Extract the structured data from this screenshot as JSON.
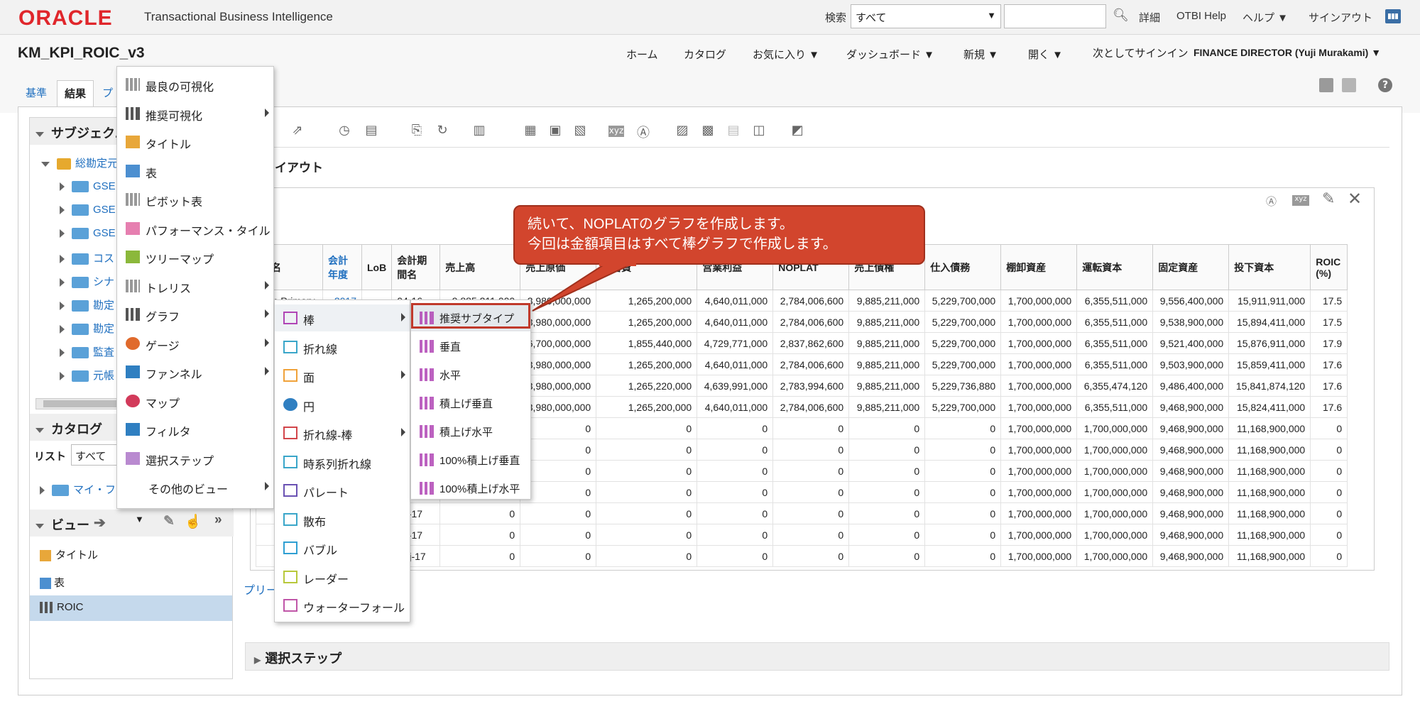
{
  "app": {
    "logo": "ORACLE",
    "product": "Transactional Business Intelligence",
    "search_label": "検索",
    "search_scope": "すべて",
    "detail": "詳細",
    "otbi_help": "OTBI Help",
    "help": "ヘルプ ▼",
    "signout": "サインアウト"
  },
  "page": {
    "title": "KM_KPI_ROIC_v3",
    "nav": [
      "ホーム",
      "カタログ",
      "お気に入り ▼",
      "ダッシュボード ▼",
      "新規 ▼",
      "開く ▼"
    ],
    "signin_as_label": "次としてサインイン",
    "signin_user": "FINANCE DIRECTOR (Yuji Murakami) ▼",
    "tabs": [
      "基準",
      "結果",
      "プ"
    ]
  },
  "left": {
    "subject_header": "サブジェク...",
    "root_item": "総勘定元",
    "tree": [
      "GSE",
      "GSE",
      "GSE",
      "コス",
      "シナ",
      "勘定",
      "勘定",
      "監査",
      "元帳"
    ],
    "catalog_header": "カタログ",
    "list_label": "リスト",
    "list_value": "すべて",
    "my_folder": "マイ・フ",
    "views_header": "ビュー",
    "views": [
      "タイトル",
      "表",
      "ROIC"
    ]
  },
  "content": {
    "layout_title": "レイアウト",
    "preview_link": "プリー",
    "selection_steps": "選択ステップ"
  },
  "callout": {
    "line1": "続いて、NOPLATのグラフを作成します。",
    "line2": "今回は金額項目はすべて棒グラフで作成します。"
  },
  "menu1": [
    {
      "label": "最良の可視化",
      "icon": "grid-icon"
    },
    {
      "label": "推奨可視化",
      "icon": "bar-chart-icon"
    },
    {
      "label": "タイトル",
      "icon": "title-icon"
    },
    {
      "label": "表",
      "icon": "table-icon"
    },
    {
      "label": "ピボット表",
      "icon": "pivot-icon"
    },
    {
      "label": "パフォーマンス・タイル",
      "icon": "tile-icon"
    },
    {
      "label": "ツリーマップ",
      "icon": "treemap-icon"
    },
    {
      "label": "トレリス",
      "icon": "trellis-icon"
    },
    {
      "label": "グラフ",
      "icon": "graph-icon"
    },
    {
      "label": "ゲージ",
      "icon": "gauge-icon"
    },
    {
      "label": "ファンネル",
      "icon": "funnel-icon"
    },
    {
      "label": "マップ",
      "icon": "map-icon"
    },
    {
      "label": "フィルタ",
      "icon": "filter-icon"
    },
    {
      "label": "選択ステップ",
      "icon": "selection-steps-icon"
    },
    {
      "label": "その他のビュー",
      "icon": ""
    }
  ],
  "menu2": [
    "棒",
    "折れ線",
    "面",
    "円",
    "折れ線-棒",
    "時系列折れ線",
    "パレート",
    "散布",
    "バブル",
    "レーダー",
    "ウォーターフォール"
  ],
  "menu3": [
    "推奨サブタイプ",
    "垂直",
    "水平",
    "積上げ垂直",
    "積上げ水平",
    "100%積上げ垂直",
    "100%積上げ水平"
  ],
  "table": {
    "headers": [
      "帳名",
      "会計年度",
      "LoB",
      "会計期間名",
      "売上高",
      "売上原価",
      "販管費",
      "営業利益",
      "NOPLAT",
      "売上債権",
      "仕入債務",
      "棚卸資産",
      "運転資本",
      "固定資産",
      "投下資本",
      "ROIC (%)"
    ],
    "rows": [
      [
        "pan Primary",
        "2017",
        "",
        "04-16",
        "9,885,211,000",
        "3,980,000,000",
        "1,265,200,000",
        "4,640,011,000",
        "2,784,006,600",
        "9,885,211,000",
        "5,229,700,000",
        "1,700,000,000",
        "6,355,511,000",
        "9,556,400,000",
        "15,911,911,000",
        "17.5"
      ],
      [
        "",
        "",
        "",
        "",
        "0",
        "3,980,000,000",
        "1,265,200,000",
        "4,640,011,000",
        "2,784,006,600",
        "9,885,211,000",
        "5,229,700,000",
        "1,700,000,000",
        "6,355,511,000",
        "9,538,900,000",
        "15,894,411,000",
        "17.5"
      ],
      [
        "",
        "",
        "",
        "",
        "0",
        "6,700,000,000",
        "1,855,440,000",
        "4,729,771,000",
        "2,837,862,600",
        "9,885,211,000",
        "5,229,700,000",
        "1,700,000,000",
        "6,355,511,000",
        "9,521,400,000",
        "15,876,911,000",
        "17.9"
      ],
      [
        "",
        "",
        "",
        "",
        "0",
        "3,980,000,000",
        "1,265,200,000",
        "4,640,011,000",
        "2,784,006,600",
        "9,885,211,000",
        "5,229,700,000",
        "1,700,000,000",
        "6,355,511,000",
        "9,503,900,000",
        "15,859,411,000",
        "17.6"
      ],
      [
        "",
        "",
        "",
        "",
        "0",
        "3,980,000,000",
        "1,265,220,000",
        "4,639,991,000",
        "2,783,994,600",
        "9,885,211,000",
        "5,229,736,880",
        "1,700,000,000",
        "6,355,474,120",
        "9,486,400,000",
        "15,841,874,120",
        "17.6"
      ],
      [
        "",
        "",
        "",
        "",
        "0",
        "3,980,000,000",
        "1,265,200,000",
        "4,640,011,000",
        "2,784,006,600",
        "9,885,211,000",
        "5,229,700,000",
        "1,700,000,000",
        "6,355,511,000",
        "9,468,900,000",
        "15,824,411,000",
        "17.6"
      ],
      [
        "",
        "",
        "",
        "",
        "0",
        "0",
        "0",
        "0",
        "0",
        "0",
        "0",
        "1,700,000,000",
        "1,700,000,000",
        "9,468,900,000",
        "11,168,900,000",
        "0"
      ],
      [
        "",
        "",
        "",
        "",
        "0",
        "0",
        "0",
        "0",
        "0",
        "0",
        "0",
        "1,700,000,000",
        "1,700,000,000",
        "9,468,900,000",
        "11,168,900,000",
        "0"
      ],
      [
        "",
        "",
        "",
        "",
        "0",
        "0",
        "0",
        "0",
        "0",
        "0",
        "0",
        "1,700,000,000",
        "1,700,000,000",
        "9,468,900,000",
        "11,168,900,000",
        "0"
      ],
      [
        "",
        "",
        "",
        "",
        "0",
        "0",
        "0",
        "0",
        "0",
        "0",
        "0",
        "1,700,000,000",
        "1,700,000,000",
        "9,468,900,000",
        "11,168,900,000",
        "0"
      ],
      [
        "",
        "",
        "",
        "02-17",
        "0",
        "0",
        "0",
        "0",
        "0",
        "0",
        "0",
        "1,700,000,000",
        "1,700,000,000",
        "9,468,900,000",
        "11,168,900,000",
        "0"
      ],
      [
        "",
        "",
        "",
        "03-17",
        "0",
        "0",
        "0",
        "0",
        "0",
        "0",
        "0",
        "1,700,000,000",
        "1,700,000,000",
        "9,468,900,000",
        "11,168,900,000",
        "0"
      ],
      [
        "",
        "",
        "",
        "Adj-17",
        "0",
        "0",
        "0",
        "0",
        "0",
        "0",
        "0",
        "1,700,000,000",
        "1,700,000,000",
        "9,468,900,000",
        "11,168,900,000",
        "0"
      ]
    ]
  }
}
